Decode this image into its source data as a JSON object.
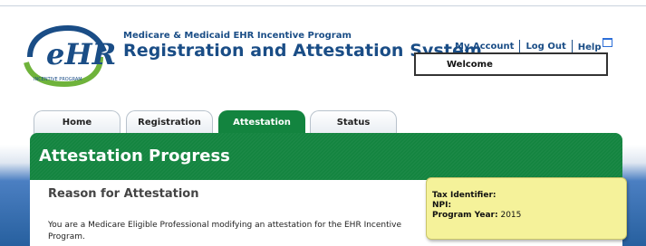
{
  "header": {
    "program_title": "Medicare & Medicaid EHR Incentive Program",
    "system_title": "Registration and Attestation System",
    "logo_text": "eHR",
    "logo_sub": "INCENTIVE PROGRAM",
    "links": {
      "my_account": "My Account",
      "log_out": "Log Out",
      "help": "Help"
    },
    "welcome": "Welcome"
  },
  "tabs": [
    {
      "label": "Home",
      "active": false
    },
    {
      "label": "Registration",
      "active": false
    },
    {
      "label": "Attestation",
      "active": true
    },
    {
      "label": "Status",
      "active": false
    }
  ],
  "banner": {
    "title": "Attestation Progress"
  },
  "main": {
    "section_title": "Reason for Attestation",
    "description": "You are a Medicare Eligible Professional modifying an attestation for the EHR Incentive Program."
  },
  "info_box": {
    "tax_identifier_label": "Tax Identifier:",
    "tax_identifier_value": "",
    "npi_label": "NPI:",
    "npi_value": "",
    "program_year_label": "Program Year:",
    "program_year_value": "2015"
  },
  "colors": {
    "brand_blue": "#1a4d86",
    "accent_green": "#13843f",
    "info_yellow": "#f5f29a"
  }
}
